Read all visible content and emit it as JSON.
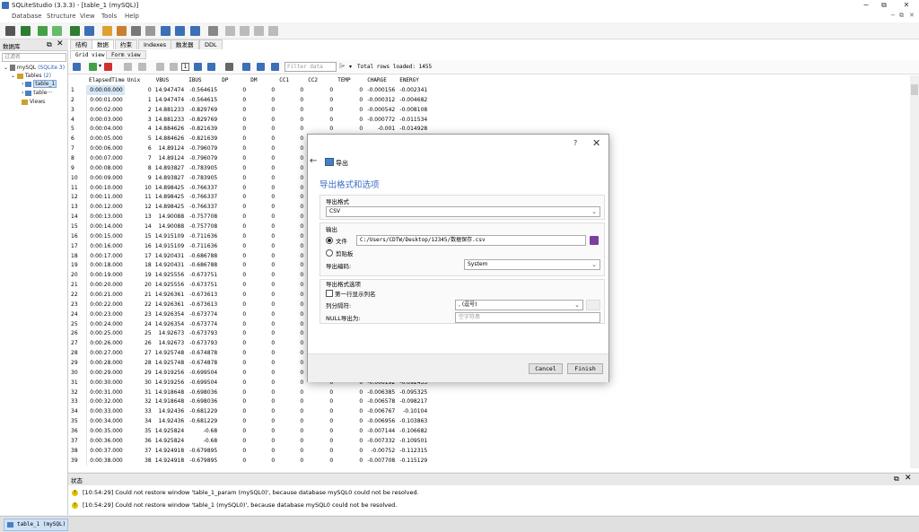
{
  "window": {
    "title": "SQLiteStudio (3.3.3) - [table_1 (mySQL)]",
    "controls": [
      "−",
      "⧉",
      "✕"
    ]
  },
  "menubar": [
    "Database",
    "Structure",
    "View",
    "Tools",
    "Help"
  ],
  "left_panel": {
    "title": "数据库",
    "filter_placeholder": "过滤名",
    "db_name": "mySQL",
    "db_type": "(SQLite 3)",
    "tables_label": "Tables",
    "tables_count": "(2)",
    "table1": "table_1",
    "table2": "table···",
    "views_label": "Views"
  },
  "editor": {
    "tabs": [
      "结构",
      "数据",
      "约束",
      "Indexes",
      "触发器",
      "DDL"
    ],
    "subtabs": [
      "Grid view",
      "Form view"
    ],
    "page_number": "1",
    "filter_placeholder": "Filter data",
    "total_rows": "Total rows loaded: 1455"
  },
  "grid": {
    "columns": [
      "ElapsedTime",
      "Unix",
      "VBUS",
      "IBUS",
      "DP",
      "DM",
      "CC1",
      "CC2",
      "TEMP",
      "CHARGE",
      "ENERGY"
    ],
    "rows": [
      [
        "1",
        "0:00:00.000",
        "0",
        "14.947474",
        "-0.564615",
        "0",
        "0",
        "0",
        "0",
        "0",
        "-0.000156",
        "-0.002341"
      ],
      [
        "2",
        "0:00:01.000",
        "1",
        "14.947474",
        "-0.564615",
        "0",
        "0",
        "0",
        "0",
        "0",
        "-0.000312",
        "-0.004682"
      ],
      [
        "3",
        "0:00:02.000",
        "2",
        "14.881233",
        "-0.829769",
        "0",
        "0",
        "0",
        "0",
        "0",
        "-0.000542",
        "-0.008108"
      ],
      [
        "4",
        "0:00:03.000",
        "3",
        "14.881233",
        "-0.829769",
        "0",
        "0",
        "0",
        "0",
        "0",
        "-0.000772",
        "-0.011534"
      ],
      [
        "5",
        "0:00:04.000",
        "4",
        "14.884626",
        "-0.821639",
        "0",
        "0",
        "0",
        "0",
        "0",
        "-0.001",
        "-0.014928"
      ],
      [
        "6",
        "0:00:05.000",
        "5",
        "14.884626",
        "-0.821639",
        "0",
        "0",
        "0",
        "",
        "",
        "",
        ""
      ],
      [
        "7",
        "0:00:06.000",
        "6",
        "14.89124",
        "-0.796079",
        "0",
        "0",
        "0",
        "",
        "",
        "",
        ""
      ],
      [
        "8",
        "0:00:07.000",
        "7",
        "14.89124",
        "-0.796079",
        "0",
        "0",
        "0",
        "",
        "",
        "",
        ""
      ],
      [
        "9",
        "0:00:08.000",
        "8",
        "14.893827",
        "-0.783905",
        "0",
        "0",
        "0",
        "",
        "",
        "",
        ""
      ],
      [
        "10",
        "0:00:09.000",
        "9",
        "14.893827",
        "-0.783905",
        "0",
        "0",
        "0",
        "",
        "",
        "",
        ""
      ],
      [
        "11",
        "0:00:10.000",
        "10",
        "14.898425",
        "-0.766337",
        "0",
        "0",
        "0",
        "",
        "",
        "",
        ""
      ],
      [
        "12",
        "0:00:11.000",
        "11",
        "14.898425",
        "-0.766337",
        "0",
        "0",
        "0",
        "",
        "",
        "",
        ""
      ],
      [
        "13",
        "0:00:12.000",
        "12",
        "14.898425",
        "-0.766337",
        "0",
        "0",
        "0",
        "",
        "",
        "",
        ""
      ],
      [
        "14",
        "0:00:13.000",
        "13",
        "14.90088",
        "-0.757708",
        "0",
        "0",
        "0",
        "",
        "",
        "",
        ""
      ],
      [
        "15",
        "0:00:14.000",
        "14",
        "14.90088",
        "-0.757708",
        "0",
        "0",
        "0",
        "",
        "",
        "",
        ""
      ],
      [
        "16",
        "0:00:15.000",
        "15",
        "14.915109",
        "-0.711636",
        "0",
        "0",
        "0",
        "",
        "",
        "",
        ""
      ],
      [
        "17",
        "0:00:16.000",
        "16",
        "14.915109",
        "-0.711636",
        "0",
        "0",
        "0",
        "",
        "",
        "",
        ""
      ],
      [
        "18",
        "0:00:17.000",
        "17",
        "14.920431",
        "-0.686788",
        "0",
        "0",
        "0",
        "",
        "",
        "",
        ""
      ],
      [
        "19",
        "0:00:18.000",
        "18",
        "14.920431",
        "-0.686788",
        "0",
        "0",
        "0",
        "",
        "",
        "",
        ""
      ],
      [
        "20",
        "0:00:19.000",
        "19",
        "14.925556",
        "-0.673751",
        "0",
        "0",
        "0",
        "",
        "",
        "",
        ""
      ],
      [
        "21",
        "0:00:20.000",
        "20",
        "14.925556",
        "-0.673751",
        "0",
        "0",
        "0",
        "",
        "",
        "",
        ""
      ],
      [
        "22",
        "0:00:21.000",
        "21",
        "14.926361",
        "-0.673613",
        "0",
        "0",
        "0",
        "",
        "",
        "",
        ""
      ],
      [
        "23",
        "0:00:22.000",
        "22",
        "14.926361",
        "-0.673613",
        "0",
        "0",
        "0",
        "",
        "",
        "",
        ""
      ],
      [
        "24",
        "0:00:23.000",
        "23",
        "14.926354",
        "-0.673774",
        "0",
        "0",
        "0",
        "",
        "",
        "",
        ""
      ],
      [
        "25",
        "0:00:24.000",
        "24",
        "14.926354",
        "-0.673774",
        "0",
        "0",
        "0",
        "",
        "",
        "",
        ""
      ],
      [
        "26",
        "0:00:25.000",
        "25",
        "14.92673",
        "-0.673793",
        "0",
        "0",
        "0",
        "",
        "",
        "",
        ""
      ],
      [
        "27",
        "0:00:26.000",
        "26",
        "14.92673",
        "-0.673793",
        "0",
        "0",
        "0",
        "",
        "",
        "",
        ""
      ],
      [
        "28",
        "0:00:27.000",
        "27",
        "14.925748",
        "-0.674878",
        "0",
        "0",
        "0",
        "",
        "",
        "",
        ""
      ],
      [
        "29",
        "0:00:28.000",
        "28",
        "14.925748",
        "-0.674878",
        "0",
        "0",
        "0",
        "",
        "",
        "",
        ""
      ],
      [
        "30",
        "0:00:29.000",
        "29",
        "14.919256",
        "-0.699504",
        "0",
        "0",
        "0",
        "",
        "",
        "",
        ""
      ],
      [
        "31",
        "0:00:30.000",
        "30",
        "14.919256",
        "-0.699504",
        "0",
        "0",
        "0",
        "0",
        "0",
        "-0.006192",
        "-0.092433"
      ],
      [
        "32",
        "0:00:31.000",
        "31",
        "14.918648",
        "-0.698036",
        "0",
        "0",
        "0",
        "0",
        "0",
        "-0.006385",
        "-0.095325"
      ],
      [
        "33",
        "0:00:32.000",
        "32",
        "14.918648",
        "-0.698036",
        "0",
        "0",
        "0",
        "0",
        "0",
        "-0.006578",
        "-0.098217"
      ],
      [
        "34",
        "0:00:33.000",
        "33",
        "14.92436",
        "-0.681229",
        "0",
        "0",
        "0",
        "0",
        "0",
        "-0.006767",
        "-0.10104"
      ],
      [
        "35",
        "0:00:34.000",
        "34",
        "14.92436",
        "-0.681229",
        "0",
        "0",
        "0",
        "0",
        "0",
        "-0.006956",
        "-0.103863"
      ],
      [
        "36",
        "0:00:35.000",
        "35",
        "14.925824",
        "-0.68",
        "0",
        "0",
        "0",
        "0",
        "0",
        "-0.007144",
        "-0.106682"
      ],
      [
        "37",
        "0:00:36.000",
        "36",
        "14.925824",
        "-0.68",
        "0",
        "0",
        "0",
        "0",
        "0",
        "-0.007332",
        "-0.109501"
      ],
      [
        "38",
        "0:00:37.000",
        "37",
        "14.924918",
        "-0.679895",
        "0",
        "0",
        "0",
        "0",
        "0",
        "-0.00752",
        "-0.112315"
      ],
      [
        "39",
        "0:00:38.000",
        "38",
        "14.924918",
        "-0.679895",
        "0",
        "0",
        "0",
        "0",
        "0",
        "-0.007708",
        "-0.115129"
      ]
    ]
  },
  "status_panel": {
    "title": "状态",
    "messages": [
      "[10:54:29]  Could not restore window 'table_1_param (mySQL0)', because database mySQL0 could not be resolved.",
      "[10:54:29]  Could not restore window 'table_1 (mySQL0)', because database mySQL0 could not be resolved."
    ]
  },
  "taskbar": {
    "item": "table_1 (mySQL)"
  },
  "dialog": {
    "help": "?",
    "close": "✕",
    "back": "←",
    "title": "导出",
    "heading": "导出格式和选项",
    "format_group": "导出格式",
    "format_value": "CSV",
    "output_group": "输出",
    "file_label": "文件",
    "file_path": "C:/Users/CDTW/Desktop/12345/数据保存.csv",
    "clipboard_label": "剪贴板",
    "encoding_label": "导出编码:",
    "encoding_value": "System",
    "options_group": "导出格式选项",
    "first_row_label": "第一行显示列名",
    "separator_label": "列分隔符:",
    "separator_value": ", (逗号)",
    "null_label": "NULL导出为:",
    "null_placeholder": "空字符串",
    "cancel": "Cancel",
    "finish": "Finish"
  },
  "colors": {
    "accent": "#3a6fc3",
    "selected_cell": "#d6e6f7",
    "warning": "#e4c000"
  }
}
